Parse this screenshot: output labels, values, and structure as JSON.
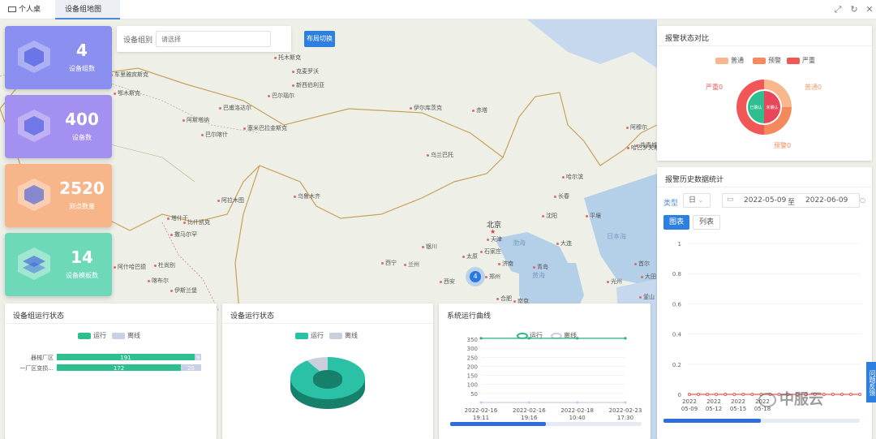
{
  "tabs": [
    {
      "label": "个人桌面",
      "active": false
    },
    {
      "label": "设备组地图",
      "active": true
    }
  ],
  "toolbar_icons": [
    "fullscreen-icon",
    "refresh-icon",
    "close-icon"
  ],
  "filter": {
    "label": "设备组别",
    "placeholder": "请选择",
    "layout_button": "布局切换"
  },
  "stat_cards": [
    {
      "value": "4",
      "label": "设备组数",
      "color": "#8b8ff0"
    },
    {
      "value": "400",
      "label": "设备数",
      "color": "#a490f0"
    },
    {
      "value": "2520",
      "label": "测点数量",
      "color": "#f6b68a"
    },
    {
      "value": "14",
      "label": "设备模板数",
      "color": "#6ed9b8"
    }
  ],
  "map": {
    "cities": [
      "托木斯克",
      "克麦罗沃",
      "车里雅宾斯克",
      "巴尔瑙尔",
      "新西伯利亚",
      "鄂木斯克",
      "巴甫洛达尔",
      "巴尔喀什",
      "阿斯塔纳",
      "塞米巴拉金斯克",
      "伊尔库茨克",
      "赤塔",
      "乌兰巴托",
      "哈尔滨",
      "长春",
      "沈阳",
      "大连",
      "平壤",
      "首尔",
      "大田",
      "光州",
      "釜山",
      "乌鲁木齐",
      "阿拉木图",
      "比什凯克",
      "杜尚别",
      "塔什干",
      "伊斯兰堡",
      "喀布尔",
      "银川",
      "兰州",
      "西宁",
      "西安",
      "太原",
      "石家庄",
      "济南",
      "青岛",
      "郑州",
      "天津",
      "南京",
      "合肥",
      "撒马尔罕",
      "阿什哈巴德",
      "哈巴罗夫斯克（伯力）",
      "阿穆尔",
      "共青城"
    ],
    "capital": "北京",
    "sea_labels": [
      "渤海",
      "黄海",
      "日本海"
    ],
    "cluster_count": "4"
  },
  "alarm_compare": {
    "title": "报警状态对比",
    "legend": [
      "普通",
      "预警",
      "严重"
    ],
    "colors": [
      "#f9b78d",
      "#f48a5c",
      "#f25757"
    ],
    "slices": [
      {
        "name": "普通",
        "value": 0,
        "label": "普通0"
      },
      {
        "name": "预警",
        "value": 0,
        "label": "预警0"
      },
      {
        "name": "严重",
        "value": 0,
        "label": "严重0"
      }
    ],
    "inner_labels": [
      "已确认",
      "未确认"
    ]
  },
  "alarm_history": {
    "title": "报警历史数据统计",
    "type_label": "类型",
    "type_value": "日",
    "date_from": "2022-05-09",
    "date_to_label": "至",
    "date_to": "2022-06-09",
    "view_tabs": [
      "图表",
      "列表"
    ],
    "chart_data": {
      "type": "line",
      "x": [
        "2022\n05-09",
        "2022\n05-12",
        "2022\n05-15",
        "2022\n05-18"
      ],
      "y_ticks": [
        0,
        0.2,
        0.4,
        0.6,
        0.8,
        1
      ],
      "ylim": [
        0,
        1
      ],
      "series": [
        {
          "color": "#e85b5b",
          "values": [
            0,
            0,
            0,
            0,
            0,
            0,
            0,
            0,
            0,
            0,
            0,
            0,
            0,
            0,
            0,
            0,
            0,
            0,
            0,
            0
          ]
        }
      ]
    }
  },
  "group_status": {
    "title": "设备组运行状态",
    "legend": [
      "运行",
      "离线"
    ],
    "chart_data": {
      "type": "bar",
      "categories": [
        "器械厂区",
        "一厂区变损..."
      ],
      "series": [
        {
          "name": "运行",
          "values": [
            191,
            172
          ],
          "color": "#2dbf90"
        },
        {
          "name": "离线",
          "values": [
            9,
            28
          ],
          "color": "#c8cfe6"
        }
      ]
    }
  },
  "device_status": {
    "title": "设备运行状态",
    "legend": [
      "运行",
      "离线"
    ],
    "chart_data": {
      "type": "pie",
      "slices": [
        {
          "name": "运行",
          "value": 363,
          "color": "#2bc1a6"
        },
        {
          "name": "离线",
          "value": 37,
          "color": "#c9cfdd"
        }
      ]
    }
  },
  "system_curve": {
    "title": "系统运行曲线",
    "legend": [
      "运行",
      "离线"
    ],
    "chart_data": {
      "type": "line",
      "x": [
        "2022-02-16\n19:11",
        "2022-02-16\n19:16",
        "2022-02-18\n10:40",
        "2022-02-23\n17:30"
      ],
      "ylim": [
        0,
        350
      ],
      "y_ticks": [
        50,
        100,
        150,
        200,
        250,
        300,
        350
      ],
      "series": [
        {
          "name": "运行",
          "values": [
            355,
            355,
            355,
            355
          ],
          "color": "#2bb386"
        },
        {
          "name": "离线",
          "values": [
            0,
            0,
            0,
            0
          ],
          "color": "#c8cfe6"
        }
      ]
    }
  },
  "side_tab": "问题反馈",
  "watermark": "中服云"
}
